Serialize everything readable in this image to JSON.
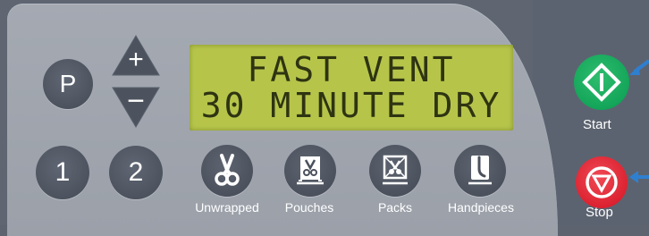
{
  "program_button": {
    "label": "P"
  },
  "arrows": {
    "up_label": "+",
    "down_label": "−"
  },
  "lcd": {
    "line1": "FAST VENT",
    "line2": "30 MINUTE DRY"
  },
  "number_buttons": [
    {
      "label": "1"
    },
    {
      "label": "2"
    }
  ],
  "cycles": [
    {
      "label": "Unwrapped",
      "icon": "scissors-icon"
    },
    {
      "label": "Pouches",
      "icon": "pouch-icon"
    },
    {
      "label": "Packs",
      "icon": "pack-icon"
    },
    {
      "label": "Handpieces",
      "icon": "handpiece-icon"
    }
  ],
  "start": {
    "label": "Start",
    "color": "#13a559"
  },
  "stop": {
    "label": "Stop",
    "color": "#dc2231"
  },
  "colors": {
    "lcd_bg": "#b6c54a",
    "lcd_text": "#2f3412",
    "panel": "#9fa4ad",
    "dark_zone": "#5c6370",
    "pointer": "#2f7fd0"
  }
}
